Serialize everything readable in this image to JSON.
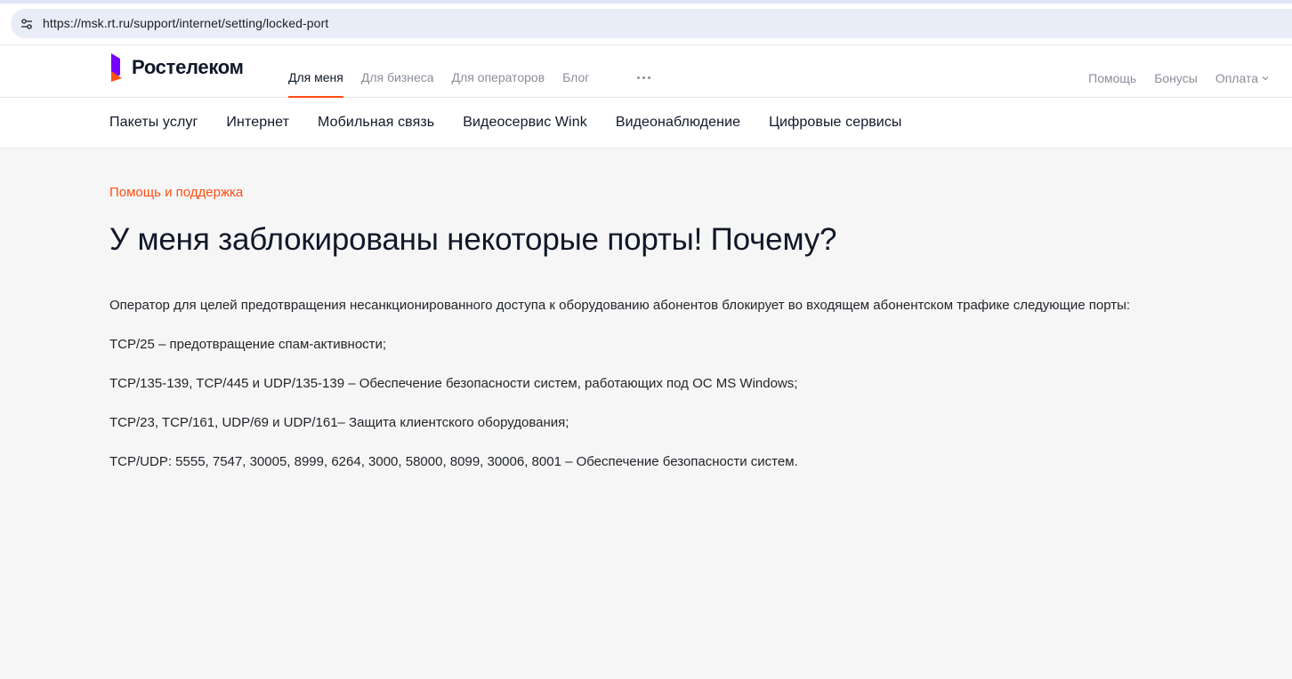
{
  "browser": {
    "url": "https://msk.rt.ru/support/internet/setting/locked-port",
    "site_info_icon": "tune-icon"
  },
  "header": {
    "logo_text": "Ростелеком",
    "main_nav": [
      {
        "label": "Для меня",
        "active": true
      },
      {
        "label": "Для бизнеса",
        "active": false
      },
      {
        "label": "Для операторов",
        "active": false
      },
      {
        "label": "Блог",
        "active": false
      }
    ],
    "more_icon": "more-horizontal-icon",
    "right_nav": [
      {
        "label": "Помощь"
      },
      {
        "label": "Бонусы"
      },
      {
        "label": "Оплата"
      }
    ]
  },
  "categories": [
    "Пакеты услуг",
    "Интернет",
    "Мобильная связь",
    "Видеосервис Wink",
    "Видеонаблюдение",
    "Цифровые сервисы"
  ],
  "content": {
    "breadcrumb": "Помощь и поддержка",
    "title": "У меня заблокированы некоторые порты! Почему?",
    "paragraphs": [
      "Оператор для целей предотвращения несанкционированного доступа к оборудованию абонентов блокирует во входящем абонентском трафике следующие порты:",
      "TCP/25 – предотвращение спам-активности;",
      "TCP/135-139, TCP/445 и UDP/135-139 – Обеспечение безопасности систем, работающих под ОС MS Windows;",
      "TCP/23, TCP/161, UDP/69 и UDP/161– Защита клиентского оборудования;",
      "TCP/UDP: 5555, 7547, 30005, 8999, 6264, 3000, 58000, 8099, 30006, 8001 – Обеспечение безопасности систем."
    ]
  },
  "colors": {
    "accent": "#ff4f12",
    "logo_purple": "#7700ff",
    "text": "#101828",
    "muted": "#8a8f98",
    "page_bg": "#f6f6f6"
  }
}
